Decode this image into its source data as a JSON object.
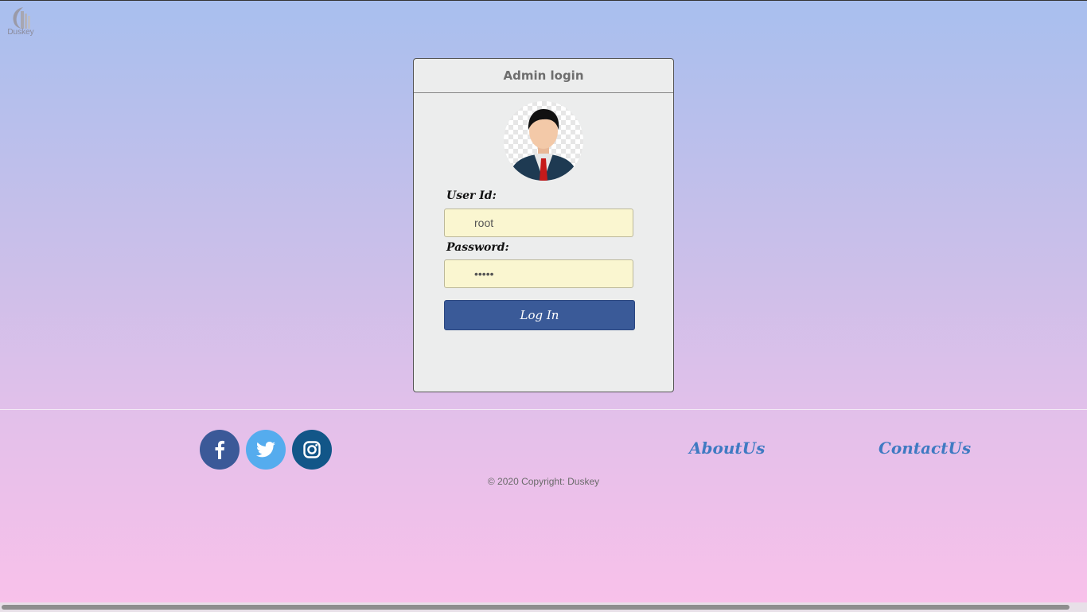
{
  "brand": {
    "name": "Duskey"
  },
  "login": {
    "title": "Admin login",
    "avatar_icon": "admin-avatar-icon",
    "user_label": "User Id:",
    "user_value": "root",
    "password_label": "Password:",
    "password_value": "•••••",
    "submit_label": "Log In",
    "accent_color": "#3a5a98"
  },
  "footer": {
    "social": [
      {
        "name": "facebook-icon",
        "color": "#3b5998"
      },
      {
        "name": "twitter-icon",
        "color": "#55acee"
      },
      {
        "name": "instagram-icon",
        "color": "#125688"
      }
    ],
    "about_label": "AboutUs",
    "contact_label": "ContactUs",
    "copyright": "© 2020 Copyright: Duskey"
  }
}
